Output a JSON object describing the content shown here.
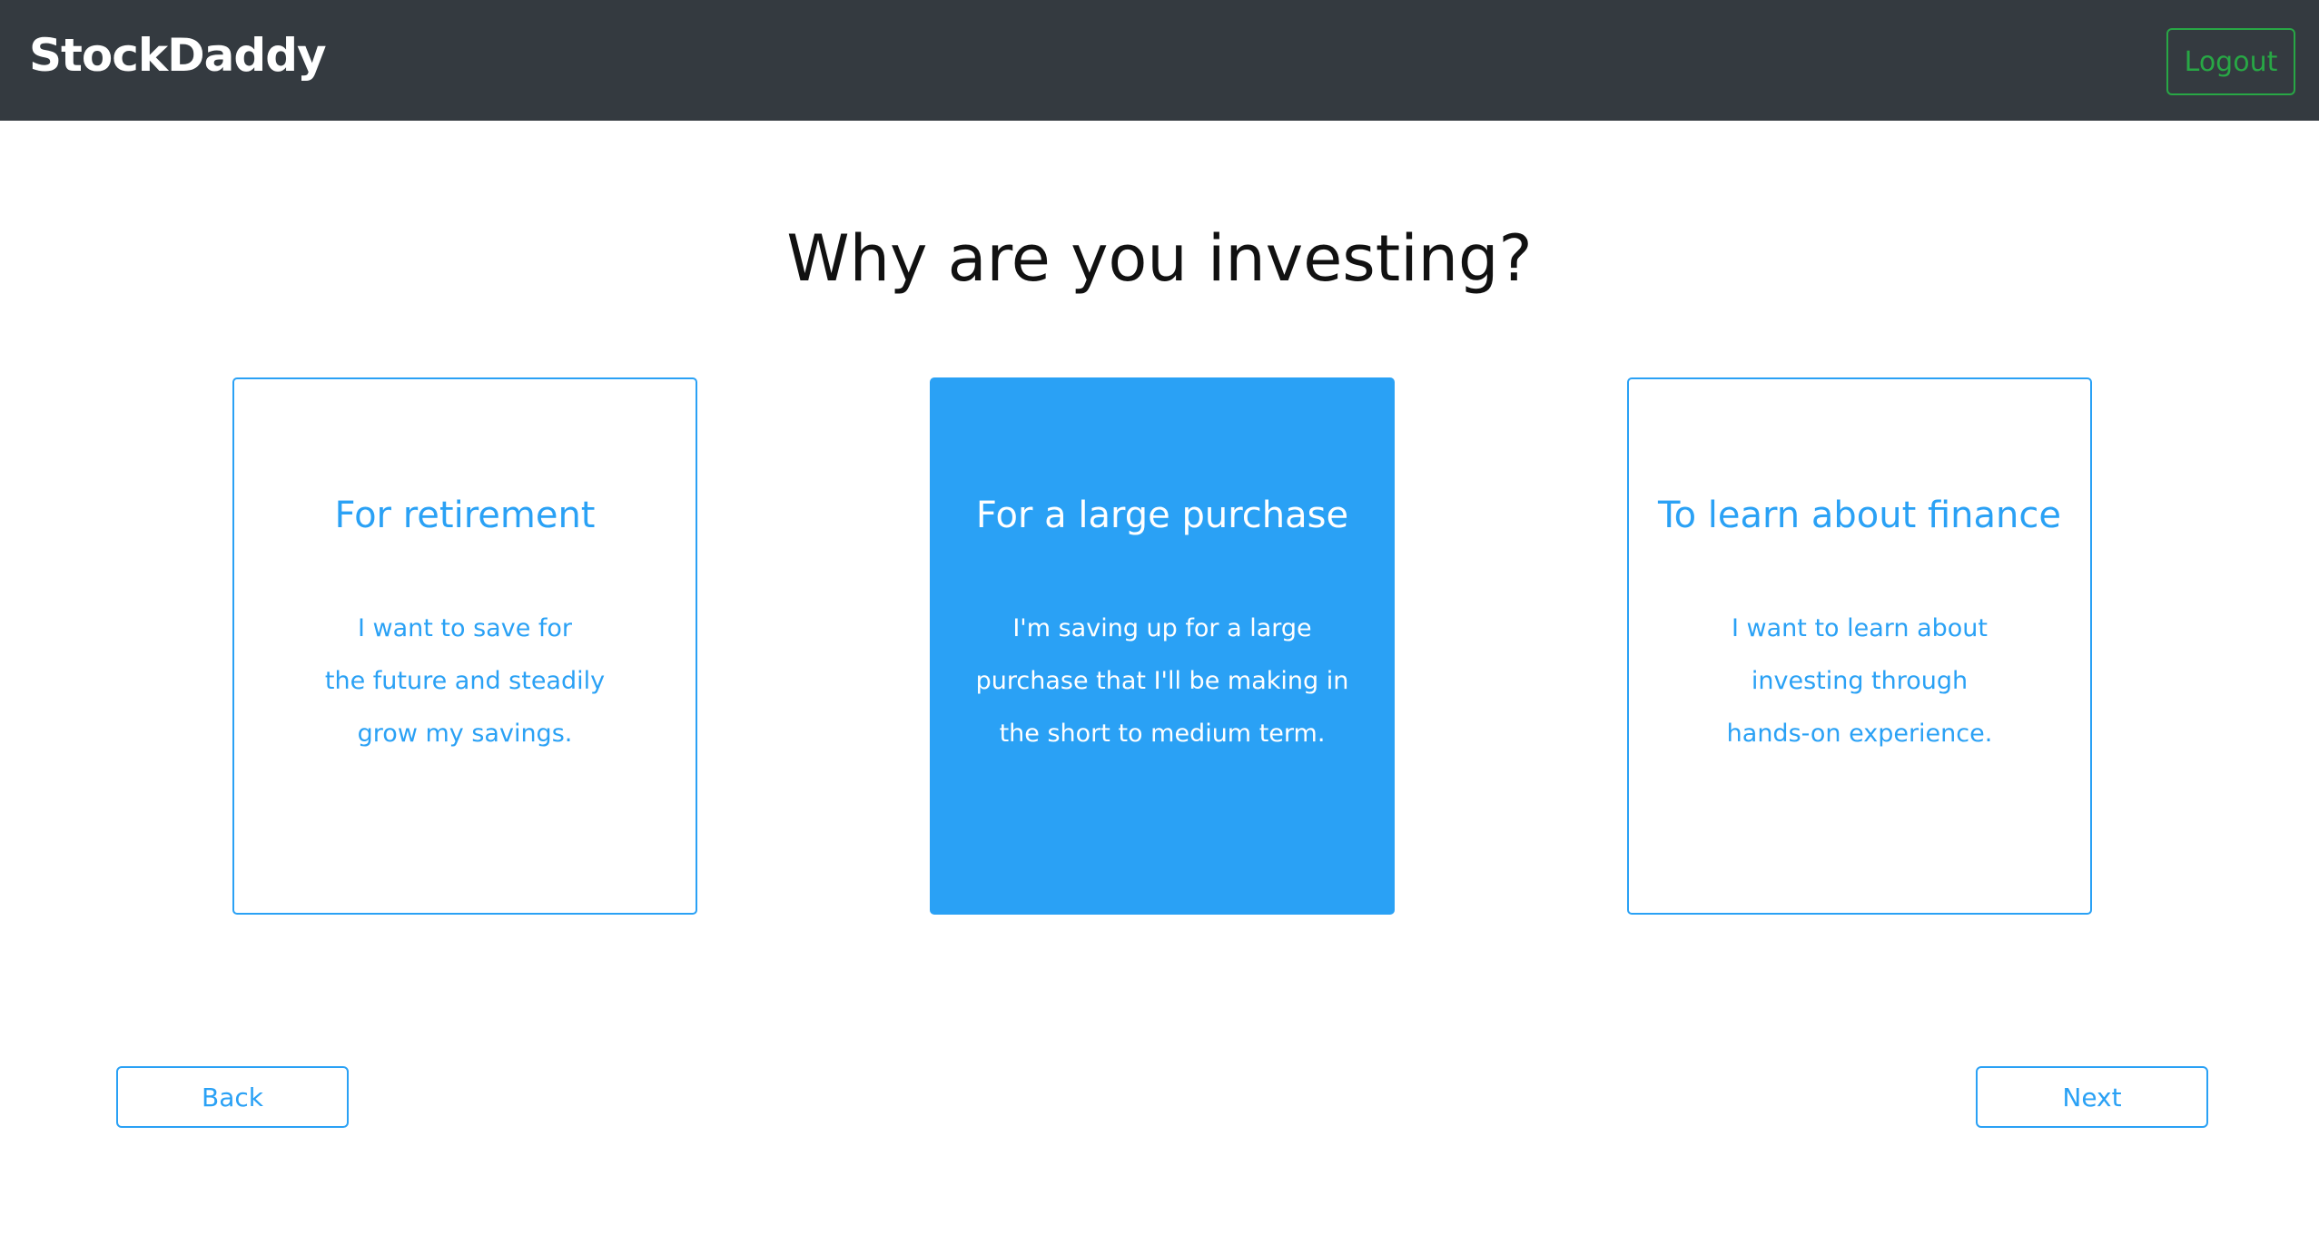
{
  "navbar": {
    "brand": "StockDaddy",
    "logout_label": "Logout"
  },
  "main": {
    "title": "Why are you investing?",
    "options": [
      {
        "title": "For retirement",
        "description": [
          "I want to save for",
          "the future and steadily",
          "grow my savings."
        ],
        "selected": false
      },
      {
        "title": "For a large purchase",
        "description": [
          "I'm saving up for a large",
          "purchase that I'll be making in",
          "the short to medium term."
        ],
        "selected": true
      },
      {
        "title": "To learn about finance",
        "description": [
          "I want to learn about",
          "investing through",
          "hands-on experience."
        ],
        "selected": false
      }
    ],
    "back_label": "Back",
    "next_label": "Next"
  },
  "colors": {
    "navbar_bg": "#343a40",
    "accent": "#2aa1f5",
    "logout": "#28a745"
  }
}
